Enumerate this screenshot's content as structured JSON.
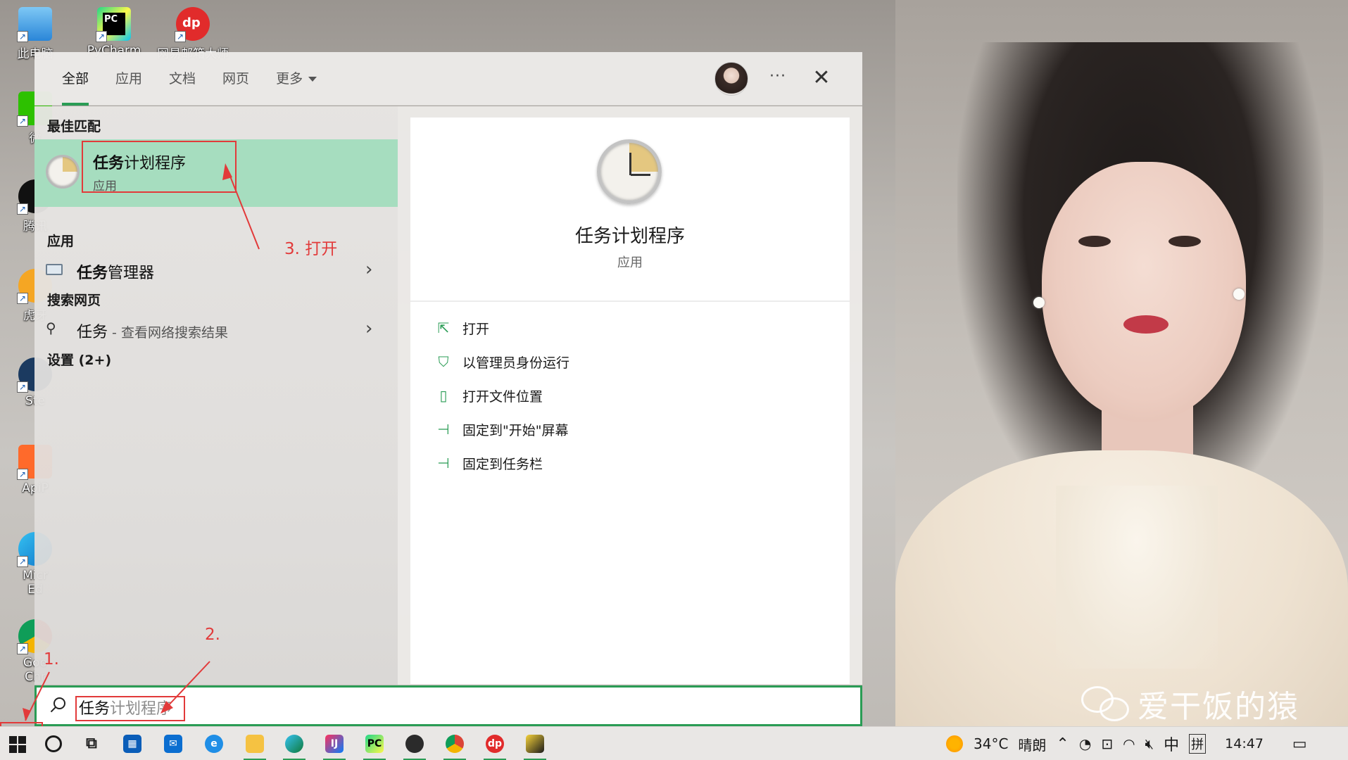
{
  "desktop": {
    "icons": [
      {
        "label": "此电脑",
        "icon": "this-pc-icon"
      },
      {
        "label": "PyCharm",
        "icon": "pycharm-icon"
      },
      {
        "label": "网易邮箱大师",
        "icon": "netease-mail-icon"
      },
      {
        "label": "微",
        "icon": "wechat-icon"
      },
      {
        "label": "腾讯",
        "icon": "tencent-icon"
      },
      {
        "label": "虎牙",
        "icon": "huya-icon"
      },
      {
        "label": "Ste",
        "icon": "steam-icon"
      },
      {
        "label": "ApiP",
        "icon": "apipost-icon"
      },
      {
        "label": "Micr Ed",
        "icon": "edge-icon"
      },
      {
        "label": "Goo Chr",
        "icon": "chrome-icon"
      }
    ]
  },
  "search": {
    "tabs": [
      "全部",
      "应用",
      "文档",
      "网页",
      "更多"
    ],
    "best_match_title": "最佳匹配",
    "best_match": {
      "name_bold": "任务",
      "name_rest": "计划程序",
      "type": "应用"
    },
    "apps_title": "应用",
    "apps": [
      {
        "name_bold": "任务",
        "name_rest": "管理器",
        "icon": "task-manager-icon"
      }
    ],
    "web_title": "搜索网页",
    "web": {
      "query": "任务",
      "suffix": " - 查看网络搜索结果",
      "icon": "search-icon"
    },
    "settings_title": "设置 (2+)",
    "preview": {
      "title": "任务计划程序",
      "subtitle": "应用"
    },
    "actions": [
      {
        "label": "打开",
        "icon": "open-icon"
      },
      {
        "label": "以管理员身份运行",
        "icon": "run-as-admin-icon"
      },
      {
        "label": "打开文件位置",
        "icon": "file-location-icon"
      },
      {
        "label": "固定到\"开始\"屏幕",
        "icon": "pin-start-icon"
      },
      {
        "label": "固定到任务栏",
        "icon": "pin-taskbar-icon"
      }
    ],
    "input": {
      "typed": "任务",
      "ghost": "计划程序"
    }
  },
  "annotations": {
    "step1": "1.",
    "step2": "2.",
    "step3": "3. 打开"
  },
  "taskbar": {
    "apps": [
      "cortana",
      "task-view",
      "store",
      "mail",
      "ie",
      "file-explorer",
      "edge",
      "intellij",
      "pycharm",
      "app-dark",
      "chrome",
      "netease-mail",
      "app-yellow"
    ],
    "weather": {
      "temp": "34°C",
      "desc": "晴朗"
    },
    "ime_lang": "中",
    "ime_mode": "拼",
    "time": "14:47"
  },
  "watermark": "爱干饭的猿",
  "colors": {
    "accent": "#2a9c55",
    "highlight": "#a6ddbf",
    "annotation": "#e23a3a"
  }
}
